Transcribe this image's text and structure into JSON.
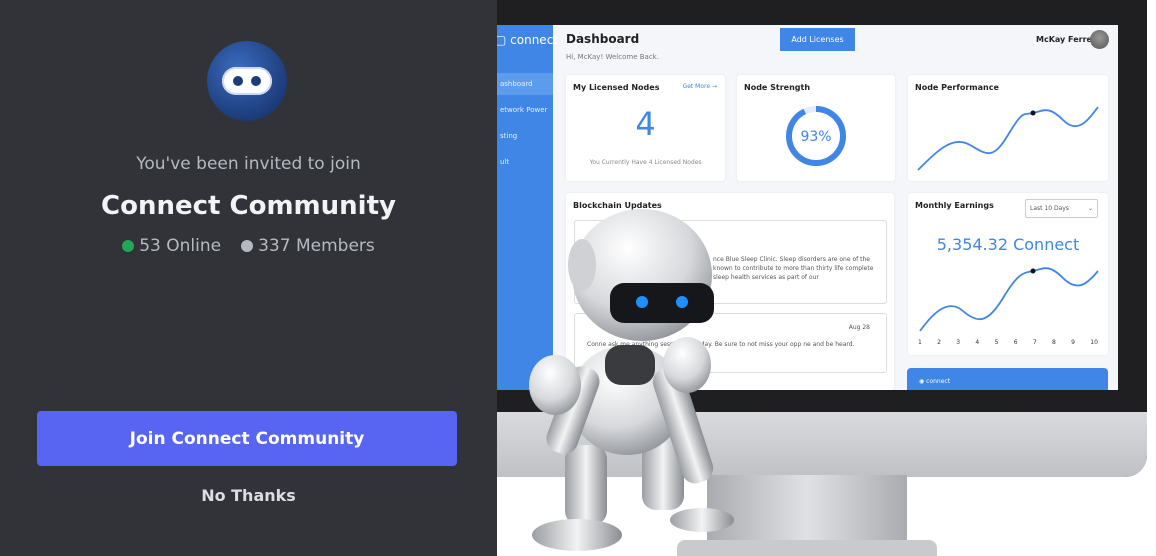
{
  "invite": {
    "invited_text": "You've been invited to join",
    "server_name": "Connect Community",
    "online": "53 Online",
    "members": "337 Members",
    "join_button": "Join Connect Community",
    "no_thanks": "No Thanks",
    "avatar_icon": "robot-icon"
  },
  "colors": {
    "background": "#313338",
    "primary_button": "#5865f2",
    "online_dot": "#23a55a",
    "members_dot": "#b5bac1",
    "dashboard_accent": "#3f86e6"
  },
  "promo": {
    "logo": "connect",
    "sidebar": [
      "ashboard",
      "etwork Power",
      "sting",
      "ult"
    ],
    "title": "Dashboard",
    "subtitle": "Hi, McKay! Welcome Back.",
    "add_licenses": "Add Licenses",
    "user": "McKay Ferre",
    "licensed_nodes": {
      "title": "My Licensed Nodes",
      "get_more": "Get More",
      "count": "4",
      "caption": "You Currently Have 4 Licensed Nodes"
    },
    "node_strength": {
      "title": "Node Strength",
      "percent": "93%",
      "value": 93
    },
    "node_performance": {
      "title": "Node Performance"
    },
    "blockchain_updates": {
      "title": "Blockchain Updates",
      "items": [
        {
          "text": "nce Blue Sleep Clinic. Sleep disorders are one of the known to contribute to more than thirty life complete sleep health services as part of our"
        },
        {
          "date": "Aug 28",
          "text": "Conne ask me anything session on Friday. Be sure to not miss your opp ne and be heard."
        }
      ]
    },
    "monthly_earnings": {
      "title": "Monthly Earnings",
      "range": "Last 10 Days",
      "amount": "5,354.32 Connect",
      "x_ticks": [
        "1",
        "2",
        "3",
        "4",
        "5",
        "6",
        "7",
        "8",
        "9",
        "10"
      ]
    },
    "footer_logo": "connect"
  }
}
